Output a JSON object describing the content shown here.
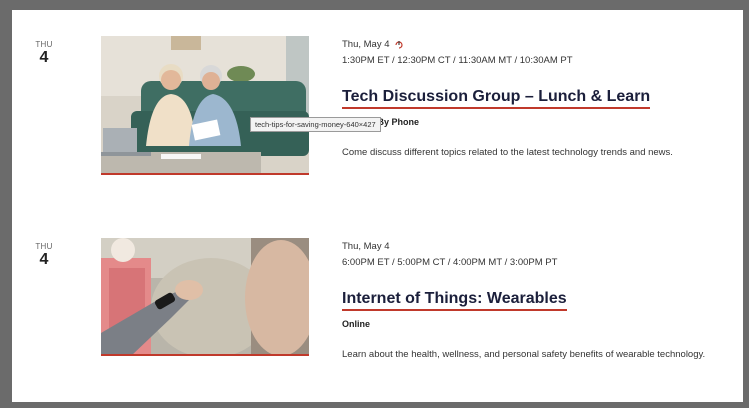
{
  "events": [
    {
      "dow": "THU",
      "day": "4",
      "date": "Thu, May 4",
      "recurring_icon": "repeat-icon",
      "time": "1:30PM ET / 12:30PM CT / 11:30AM MT / 10:30AM PT",
      "title": "Tech Discussion Group – Lunch & Learn",
      "format": "Online / By Phone",
      "description": "Come discuss different topics related to the latest technology trends and news."
    },
    {
      "dow": "THU",
      "day": "4",
      "date": "Thu, May 4",
      "time": "6:00PM ET / 5:00PM CT / 4:00PM MT / 3:00PM PT",
      "title": "Internet of Things: Wearables",
      "format": "Online",
      "description": "Learn about the health, wellness, and personal safety benefits of wearable technology."
    }
  ],
  "tooltip": "tech-tips-for-saving-money-640×427",
  "colors": {
    "accent": "#c0392b",
    "title": "#1b1f3b",
    "frame": "#6b6b6b"
  }
}
